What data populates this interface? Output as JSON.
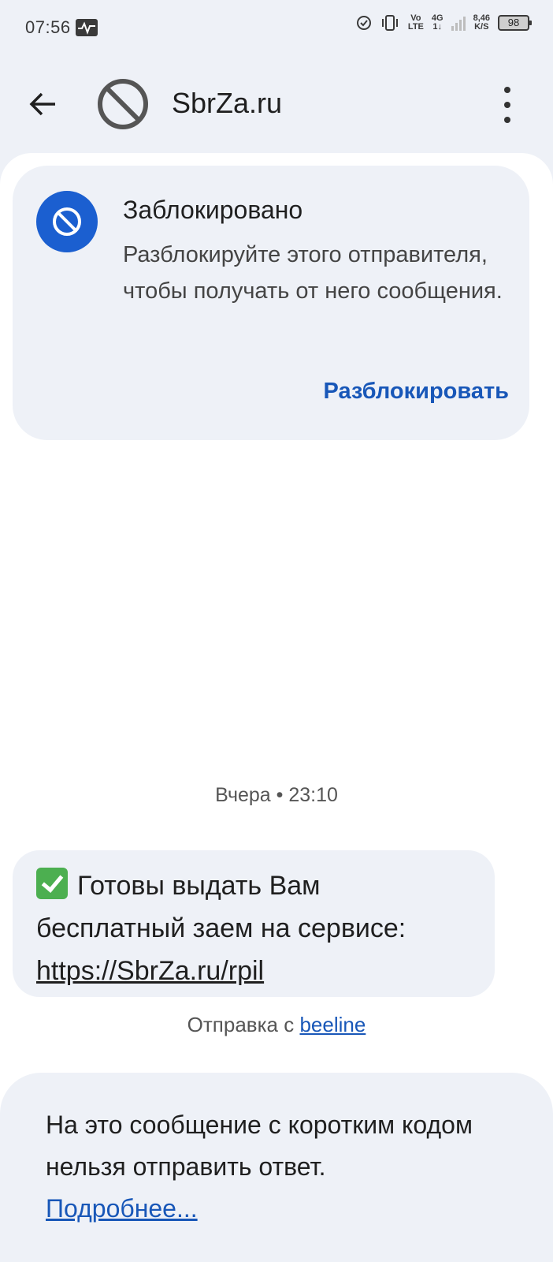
{
  "status_bar": {
    "time": "07:56",
    "volte_top": "Vo",
    "volte_bottom": "LTE",
    "network_top": "4G",
    "network_bottom": "1↓",
    "speed_top": "8,46",
    "speed_bottom": "K/S",
    "battery": "98"
  },
  "app_bar": {
    "title": "SbrZa.ru"
  },
  "blocked_card": {
    "title": "Заблокировано",
    "description": "Разблокируйте этого отправителя, чтобы получать от него сообщения.",
    "action_label": "Разблокировать"
  },
  "conversation": {
    "date_separator": "Вчера • 23:10",
    "message": {
      "text": "Готовы выдать Вам бесплатный заем на сервисе:",
      "link": "https://SbrZa.ru/rpil"
    },
    "sent_via_prefix": "Отправка с ",
    "sent_via_link": "beeline"
  },
  "reply_panel": {
    "text": "На это сообщение с коротким кодом нельзя отправить ответ.",
    "more_link": "Подробнее..."
  },
  "colors": {
    "accent_blue": "#1b5fd0",
    "link_blue": "#1857b8",
    "background": "#eef1f7"
  },
  "icons": {
    "back": "arrow-left-icon",
    "avatar": "block-icon",
    "menu": "more-vertical-icon",
    "blocked": "block-icon",
    "message_emoji": "check-mark-button-icon"
  }
}
